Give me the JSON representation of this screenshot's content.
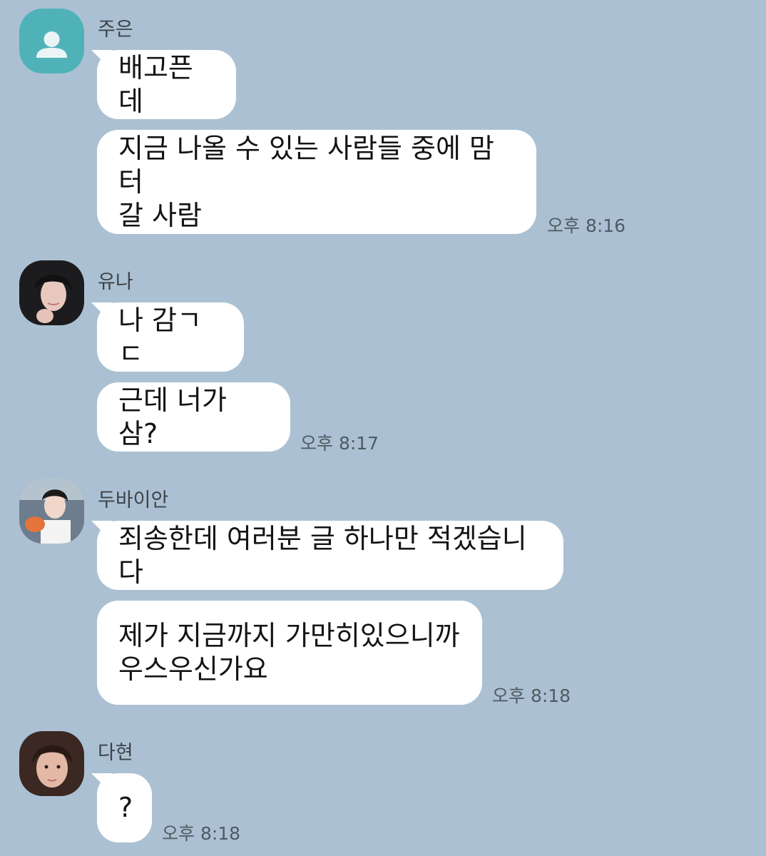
{
  "colors": {
    "background": "#abc1d3",
    "bubble": "#ffffff",
    "default_avatar": "#4fb2b9"
  },
  "messages": [
    {
      "sender": "주은",
      "avatar_icon": "person-icon",
      "bubbles": [
        "배고픈데",
        "지금 나올 수 있는 사람들 중에 맘터\n갈 사람"
      ],
      "time": "오후 8:16"
    },
    {
      "sender": "유나",
      "avatar_icon": "profile-photo",
      "bubbles": [
        "나 감ㄱㄷ",
        "근데 너가 삼?"
      ],
      "time": "오후 8:17"
    },
    {
      "sender": "두바이안",
      "avatar_icon": "profile-photo",
      "bubbles": [
        "죄송한데 여러분 글 하나만 적겠습니다",
        "제가 지금까지 가만히있으니까\n우스우신가요"
      ],
      "time": "오후 8:18"
    },
    {
      "sender": "다현",
      "avatar_icon": "profile-photo",
      "bubbles": [
        "?"
      ],
      "time": "오후 8:18"
    }
  ]
}
